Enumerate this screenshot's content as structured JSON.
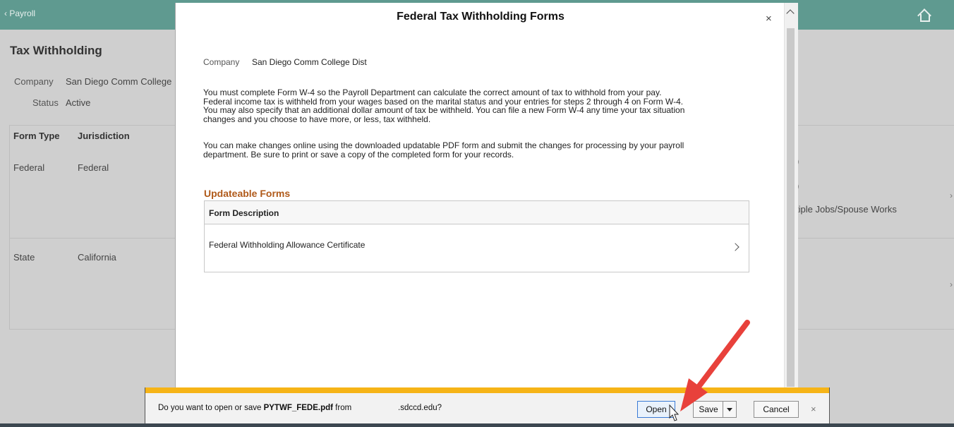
{
  "background": {
    "back_label": "Payroll",
    "page_title": "Tax Withholding",
    "company_label": "Company",
    "company_value": "San Diego Comm College",
    "status_label": "Status",
    "status_value": "Active",
    "columns": [
      "Form Type",
      "Jurisdiction"
    ],
    "rows": [
      {
        "form_type": "Federal",
        "jurisdiction": "Federal"
      },
      {
        "form_type": "State",
        "jurisdiction": "California"
      }
    ],
    "partial_text_1": ")",
    "partial_text_2": ")",
    "partial_text_3": "tiple Jobs/Spouse Works"
  },
  "modal": {
    "title": "Federal Tax Withholding Forms",
    "close_glyph": "×",
    "company_label": "Company",
    "company_value": "San Diego Comm College Dist",
    "para1_lines": [
      "You must complete Form W-4 so the Payroll Department can calculate the correct amount of tax to withhold from your pay.",
      "Federal income tax is withheld from your wages based on the marital status and your entries for steps 2 through 4 on Form W-4.",
      "You may also specify that an additional dollar amount of tax be withheld.  You can file a new Form W-4 any time your tax situation",
      "changes and you choose to have more, or less, tax withheld."
    ],
    "para2_lines": [
      "You can make changes online using the downloaded updatable PDF form and submit the changes for processing by your payroll",
      "department.  Be sure to print or save a copy of the completed form for your records."
    ],
    "section_title": "Updateable Forms",
    "table_header": "Form Description",
    "form_row": "Federal Withholding Allowance Certificate"
  },
  "download_bar": {
    "prompt_prefix": "Do you want to open or save ",
    "filename": "PYTWF_FEDE.pdf",
    "prompt_from": " from",
    "domain": ".sdccd.edu?",
    "open_label": "Open",
    "save_label": "Save",
    "cancel_label": "Cancel",
    "close_glyph": "×",
    "accent_color": "#f6b417"
  },
  "annotation": {
    "arrow_color": "#e8413b"
  },
  "colors": {
    "header": "#5f9a90",
    "section_title": "#b05a1a"
  }
}
